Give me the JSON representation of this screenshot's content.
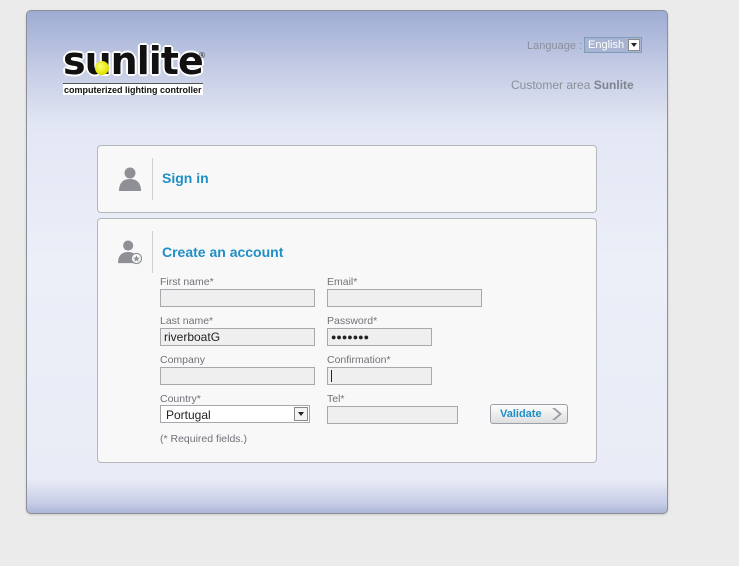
{
  "brand": {
    "logo_text": "sunlite",
    "tagline": "computerized lighting controller"
  },
  "header": {
    "language_label": "Language :",
    "language_value": "English",
    "customer_area_prefix": "Customer area",
    "customer_area_name": "Sunlite"
  },
  "signin": {
    "title": "Sign in"
  },
  "create": {
    "title": "Create an account",
    "first_name_label": "First name*",
    "first_name_value": "",
    "email_label": "Email*",
    "email_value": "",
    "last_name_label": "Last name*",
    "last_name_value": "riverboatG",
    "password_label": "Password*",
    "password_value": "●●●●●●●",
    "company_label": "Company",
    "company_value": "",
    "confirmation_label": "Confirmation*",
    "confirmation_value": "",
    "country_label": "Country*",
    "country_value": "Portugal",
    "tel_label": "Tel*",
    "tel_value": "",
    "validate_label": "Validate",
    "required_note": "(* Required fields.)"
  },
  "icons": {
    "signin": "person-icon",
    "create": "person-add-icon",
    "validate": "chevron-right-icon"
  },
  "colors": {
    "accent": "#1f8fc6",
    "frame_top": "#9eacd3",
    "panel_bg": "#f8f8f8"
  }
}
